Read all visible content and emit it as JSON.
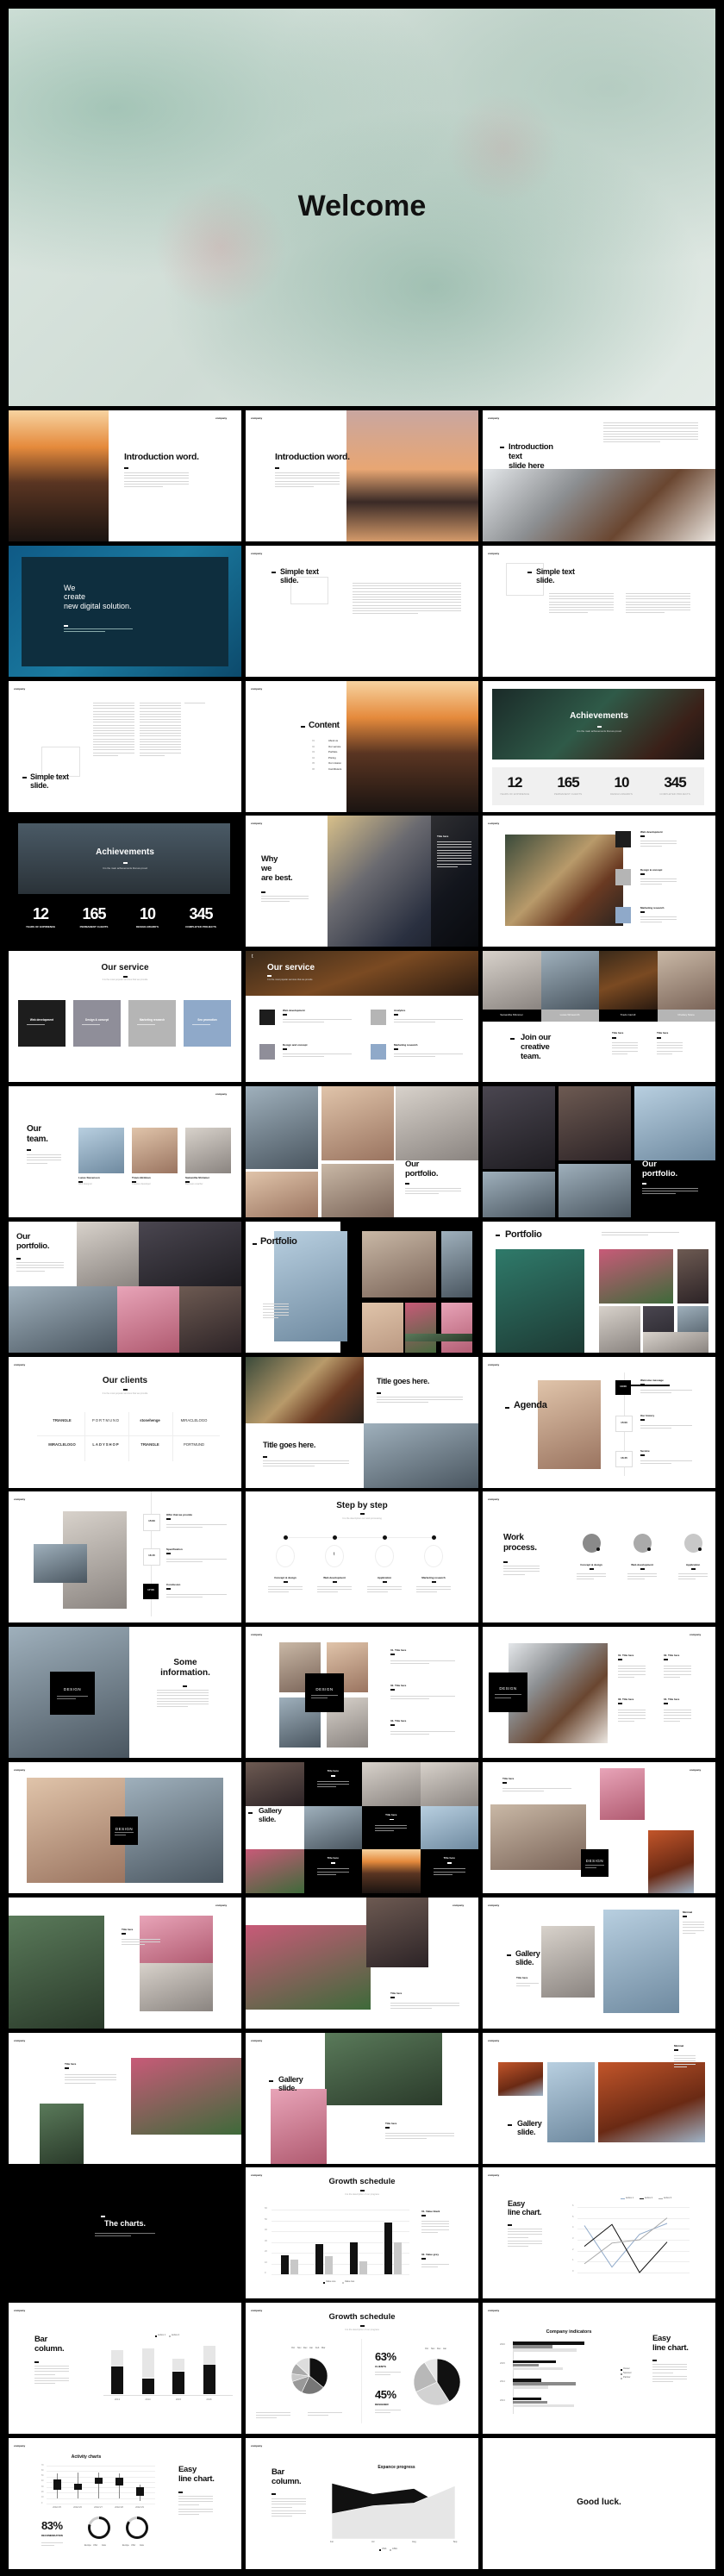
{
  "welcome": {
    "title": "Welcome"
  },
  "logo": "company",
  "slides": [
    {
      "title": "Introduction word."
    },
    {
      "title": "Introduction word."
    },
    {
      "title": "Introduction\ntext\nslide here"
    },
    {
      "title": "We\ncreate\nnew digital solution."
    },
    {
      "title": "Simple text\nslide."
    },
    {
      "title": "Simple text\nslide."
    },
    {
      "title": "Simple text\nslide."
    },
    {
      "title": "Content",
      "items": [
        "About us",
        "Our service",
        "Portfolio",
        "Pricing",
        "Our mission",
        "Contributors"
      ],
      "numbers": [
        "01",
        "02",
        "03",
        "04",
        "05",
        "06"
      ]
    },
    {
      "title": "Achievements",
      "subtitle": "It is the main achievements that we proud",
      "stats": [
        {
          "value": "12",
          "label": "YEARS OF EXPIRIENCE"
        },
        {
          "value": "165",
          "label": "PERMANENT CLIENTS"
        },
        {
          "value": "10",
          "label": "DESIGN AWARD'S"
        },
        {
          "value": "345",
          "label": "COMPLETED PROJECTS"
        }
      ]
    },
    {
      "title": "Achievements",
      "subtitle": "It is the main achievements that we proud",
      "stats": [
        {
          "value": "12",
          "label": "YEARS OF EXPIRIENCE"
        },
        {
          "value": "165",
          "label": "PERMANENT CLIENTS"
        },
        {
          "value": "10",
          "label": "DESIGN AWARD'S"
        },
        {
          "value": "345",
          "label": "COMPLETED PROJECTS"
        }
      ]
    },
    {
      "title": "Why\nwe\nare best.",
      "side_title": "Title here"
    },
    {
      "items": [
        "Web development",
        "Design & concept",
        "Marketing research"
      ],
      "icon_letter": "t"
    },
    {
      "title": "Our service",
      "subtitle": "It is the most popular services that we provide",
      "boxes": [
        {
          "label": "Web development",
          "color": "#1d1d1d"
        },
        {
          "label": "Design & concept",
          "color": "#8f8e99"
        },
        {
          "label": "Marketing research",
          "color": "#b5b5b5"
        },
        {
          "label": "Seo promotion",
          "color": "#8fa9c9"
        }
      ]
    },
    {
      "title": "Our service",
      "subtitle": "It is the most popular services that we provide",
      "items": [
        {
          "label": "Web development",
          "color": "#1d1d1d"
        },
        {
          "label": "Analytics",
          "color": "#b5b5b5"
        },
        {
          "label": "Design and concept",
          "color": "#8f8e99"
        },
        {
          "label": "Marketing research",
          "color": "#8fa9c9"
        }
      ],
      "icon_letter": "t"
    },
    {
      "title": "Join our\ncreative\nteam.",
      "names": [
        "Samantha Shimmer",
        "Lucas Winsworth",
        "Travis Carroll",
        "Chelsey Stone"
      ],
      "cols": [
        "Title here",
        "Title here"
      ]
    },
    {
      "title": "Our\nteam.",
      "names": [
        "Lucas Stevenson",
        "Travis Birdman",
        "Samantha Shimmer"
      ],
      "roles": [
        "Web designer",
        "Creative developer",
        "Business coacher"
      ]
    },
    {
      "title": "Our\nportfolio."
    },
    {
      "title": "Our\nportfolio."
    },
    {
      "title": "Our\nportfolio."
    },
    {
      "title": "Portfolio"
    },
    {
      "title": "Portfolio"
    },
    {
      "title": "Our clients",
      "subtitle": "It is the most popular services that we provide",
      "logos": [
        "TRIANGLE",
        "PORTMUND",
        "stonehenge",
        "MIRACLELOGO",
        "MIRACLELOGO",
        "LADYSHOP",
        "TRIANGLE",
        "PORTMUND"
      ]
    },
    {
      "title": "Title goes here.",
      "title2": "Title goes here."
    },
    {
      "title": "Agenda",
      "times": [
        "13:00",
        "15:00",
        "16:45"
      ],
      "items": [
        "Welcome message",
        "Our history",
        "Service"
      ]
    },
    {
      "times": [
        "15:00",
        "16:15",
        "17:00"
      ],
      "items": [
        "Offer that we provide",
        "Specification",
        "Conclusion"
      ]
    },
    {
      "title": "Step by step",
      "subtitle": "It is the description our work processing",
      "steps": [
        "Concept & design",
        "Web development",
        "Application",
        "Marketing research"
      ],
      "icon_letter": "t"
    },
    {
      "title": "Work\nprocess.",
      "steps": [
        "Concept & design",
        "Web development",
        "Application"
      ]
    },
    {
      "title": "Some\ninformation.",
      "box": "DESIGN"
    },
    {
      "box": "DESIGN",
      "items": [
        "01. Title here",
        "02. Title here",
        "03. Title here"
      ]
    },
    {
      "box": "DESIGN",
      "items": [
        "01. Title here",
        "02. Title here",
        "03. Title here",
        "04. Title here"
      ]
    },
    {
      "box": "DESIGN"
    },
    {
      "title": "Gallery\nslide.",
      "cells": [
        "Title here",
        "Title here",
        "Title here",
        "Title here"
      ]
    },
    {
      "title": "Title here",
      "box": "DESIGN"
    },
    {
      "title": "Title here"
    },
    {
      "title": "Title here"
    },
    {
      "title": "Gallery\nslide.",
      "subtitle": "Title here",
      "side": "Minimal"
    },
    {
      "title": "Title here"
    },
    {
      "title": "Gallery\nslide.",
      "subtitle": "Title here"
    },
    {
      "title": "Gallery\nslide.",
      "side": "Minimal"
    },
    {
      "title": "The charts."
    },
    {
      "title": "Growth schedule",
      "subtitle": "It is the description of our progress",
      "notes": [
        "01. Value black",
        "02. Value grey"
      ],
      "chart": {
        "type": "bar",
        "ylim": [
          0,
          60
        ],
        "yticks": [
          "0",
          "10",
          "20",
          "30",
          "40",
          "50",
          "60"
        ],
        "series": [
          {
            "name": "Value one",
            "color": "#111111",
            "values": [
              18,
              28,
              30,
              48
            ]
          },
          {
            "name": "Value two",
            "color": "#c8c8c8",
            "values": [
              14,
              17,
              12,
              30
            ]
          }
        ]
      }
    },
    {
      "title": "Easy\nline chart.",
      "chart": {
        "type": "line",
        "ylim": [
          0,
          6
        ],
        "yticks": [
          "0",
          "1",
          "2",
          "3",
          "4",
          "5",
          "6"
        ],
        "series": [
          {
            "name": "series 1",
            "color": "#8fa9c9",
            "values": [
              4.3,
              0.5,
              3.5,
              4.5
            ]
          },
          {
            "name": "series 2",
            "color": "#111111",
            "values": [
              2.4,
              4.4,
              0,
              2.8
            ]
          },
          {
            "name": "series 3",
            "color": "#a8a8a8",
            "values": [
              0.8,
              2.7,
              3,
              5
            ]
          }
        ]
      }
    },
    {
      "title": "Bar\ncolumn.",
      "chart": {
        "type": "stacked-bar",
        "categories": [
          "2013",
          "2014",
          "2015",
          "2016"
        ],
        "series": [
          {
            "name": "series 1",
            "color": "#111111",
            "values": [
              4.9,
              2.9,
              4.1,
              5.2
            ]
          },
          {
            "name": "series 2",
            "color": "#e6e6e6",
            "values": [
              2.9,
              5.1,
              2.1,
              3.3
            ]
          }
        ]
      }
    },
    {
      "title": "Growth schedule",
      "subtitle": "It is the description of our progress",
      "stats": [
        {
          "value": "63%",
          "label": "CLIENTS"
        },
        {
          "value": "45%",
          "label": "DESIGNER"
        }
      ],
      "pie1": {
        "labels": [
          "Oct",
          "Nov",
          "Dec",
          "Jan",
          "Feb",
          "Mar"
        ],
        "values": [
          36,
          21,
          13,
          7,
          10,
          13
        ],
        "colors": [
          "#111111",
          "#777777",
          "#999999",
          "#c8c8c8",
          "#aaaaaa",
          "#dddddd"
        ]
      },
      "pie2": {
        "labels": [
          "Oct",
          "Nov",
          "Dec",
          "Jan"
        ],
        "values": [
          41,
          27,
          23,
          9
        ],
        "colors": [
          "#111111",
          "#d2d2d2",
          "#b8b8b8",
          "#e6e6e6"
        ]
      }
    },
    {
      "title": "Easy\nline chart.",
      "chart_title": "Company indicators",
      "chart": {
        "type": "horizontal-bar",
        "categories": [
          "2016",
          "2015",
          "2014",
          "2013"
        ],
        "series": [
          {
            "name": "Owner",
            "color": "#111111",
            "values": [
              5,
              3,
              2,
              2
            ]
          },
          {
            "name": "Sponsor",
            "color": "#8a8a8a",
            "values": [
              2.8,
              1.8,
              4.4,
              2.4
            ]
          },
          {
            "name": "Partner",
            "color": "#e2e2e2",
            "values": [
              4.5,
              3.5,
              2.5,
              4.3
            ]
          }
        ]
      }
    },
    {
      "title": "Easy\nline chart.",
      "chart_title": "Activity charts",
      "percent": "83%",
      "percent_label": "RECOMENDATION",
      "donut_legend": [
        "Europe",
        "USA",
        "Asia"
      ],
      "chart": {
        "type": "candlestick",
        "ylim": [
          0,
          70
        ],
        "yticks": [
          "0",
          "10",
          "20",
          "30",
          "40",
          "50",
          "60",
          "70"
        ],
        "categories": [
          "2002/1/5",
          "2002/1/6",
          "2002/1/7",
          "2002/1/8",
          "2002/1/9"
        ],
        "ohlc": [
          [
            25,
            55,
            10,
            45
          ],
          [
            25,
            58,
            10,
            37
          ],
          [
            37,
            58,
            10,
            48
          ],
          [
            33,
            55,
            10,
            48
          ],
          [
            15,
            35,
            5,
            30
          ]
        ]
      },
      "donuts": [
        0.8,
        0.85
      ]
    },
    {
      "title": "Bar\ncolumn.",
      "chart_title": "Expance progress",
      "chart": {
        "type": "area",
        "categories": [
          "Jun",
          "Jul",
          "Aug",
          "Sep"
        ],
        "ylim": [
          0,
          50
        ],
        "series": [
          {
            "name": "USA",
            "color": "#111111",
            "values": [
              42,
              34,
              38,
              20
            ]
          },
          {
            "name": "ASIA",
            "color": "#e6e6e6",
            "values": [
              19,
              25,
              27,
              40
            ]
          }
        ]
      }
    },
    {
      "title": "Good luck."
    }
  ]
}
